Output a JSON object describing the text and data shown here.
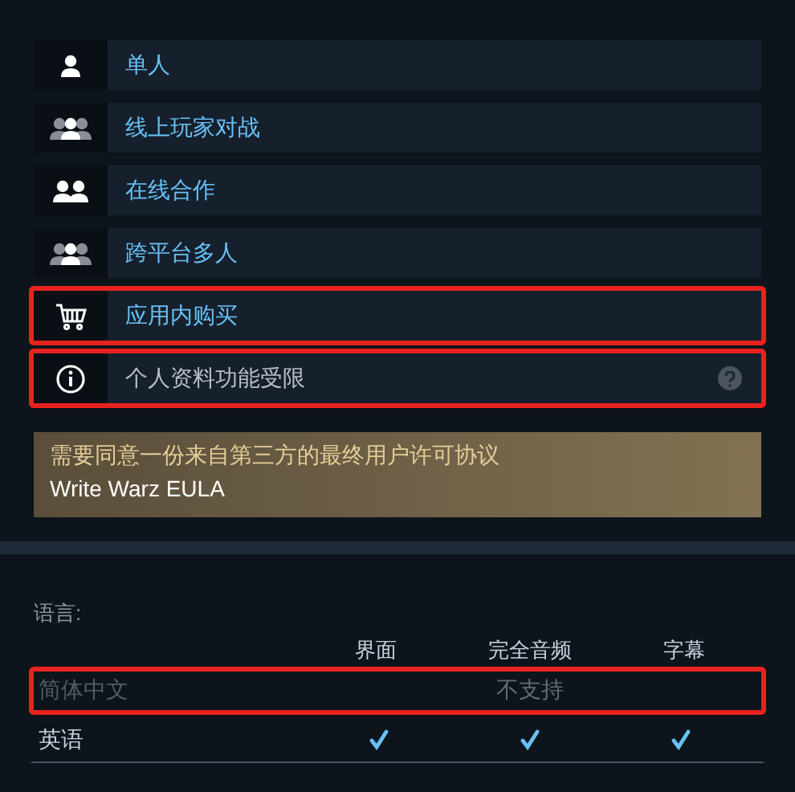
{
  "features": [
    {
      "kind": "single",
      "label": "单人",
      "dimmed": false,
      "highlighted": false,
      "help": false
    },
    {
      "kind": "group",
      "label": "线上玩家对战",
      "dimmed": false,
      "highlighted": false,
      "help": false
    },
    {
      "kind": "pair",
      "label": "在线合作",
      "dimmed": false,
      "highlighted": false,
      "help": false
    },
    {
      "kind": "group",
      "label": "跨平台多人",
      "dimmed": false,
      "highlighted": false,
      "help": false
    },
    {
      "kind": "cart",
      "label": "应用内购买",
      "dimmed": false,
      "highlighted": true,
      "help": false
    },
    {
      "kind": "info",
      "label": "个人资料功能受限",
      "dimmed": true,
      "highlighted": true,
      "help": true
    }
  ],
  "eula": {
    "notice": "需要同意一份来自第三方的最终用户许可协议",
    "link": "Write Warz EULA"
  },
  "languages": {
    "title": "语言:",
    "columns": [
      "界面",
      "完全音频",
      "字幕"
    ],
    "rows": [
      {
        "kind": "unsupported",
        "name": "简体中文",
        "note": "不支持",
        "highlighted": true
      },
      {
        "kind": "supported",
        "name": "英语",
        "checks": [
          true,
          true,
          true
        ],
        "highlighted": false
      }
    ]
  }
}
